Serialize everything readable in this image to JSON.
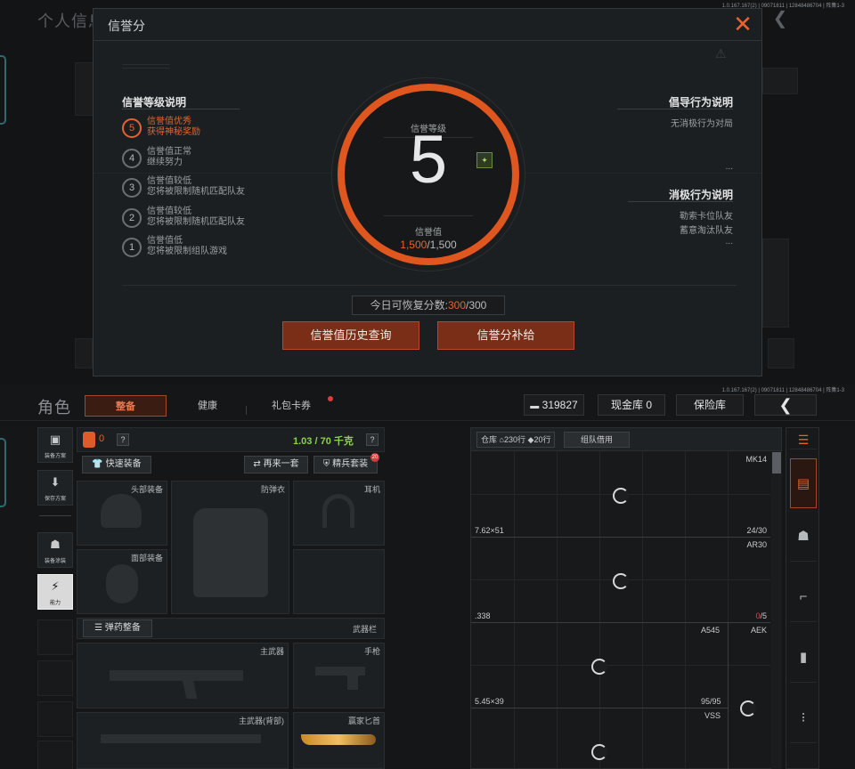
{
  "version_text": "1.0.167.167(2) | 09071811 | 12848486704 | 阵集1-3",
  "background_page": {
    "title": "个人信息"
  },
  "modal": {
    "title": "信誉分",
    "close_icon": "close-icon",
    "levels_heading": "信誉等级说明",
    "levels": [
      {
        "num": "5",
        "line1": "信誉值优秀",
        "line2": "获得神秘奖励",
        "active": true
      },
      {
        "num": "4",
        "line1": "信誉值正常",
        "line2": "继续努力",
        "active": false
      },
      {
        "num": "3",
        "line1": "信誉值较低",
        "line2": "您将被限制随机匹配队友",
        "active": false
      },
      {
        "num": "2",
        "line1": "信誉值较低",
        "line2": "您将被限制随机匹配队友",
        "active": false
      },
      {
        "num": "1",
        "line1": "信誉值低",
        "line2": "您将被限制组队游戏",
        "active": false
      }
    ],
    "center": {
      "level_label": "信誉等级",
      "level_value": "5",
      "score_label": "信誉值",
      "score_current": "1,500",
      "score_max": "/1,500"
    },
    "guide": {
      "heading": "倡导行为说明",
      "items": [
        "无消极行为对局",
        "..."
      ]
    },
    "negative": {
      "heading": "消极行为说明",
      "items": [
        "勒索卡位队友",
        "蓄意淘汰队友",
        "..."
      ]
    },
    "recover": {
      "prefix": "今日可恢复分数:",
      "current": "300",
      "max": "/300"
    },
    "buttons": {
      "history": "信誉值历史查询",
      "supplement": "信誉分补给"
    }
  },
  "loadout": {
    "title": "角色",
    "tabs": [
      {
        "label": "整备",
        "active": true
      },
      {
        "label": "健康",
        "active": false
      },
      {
        "label": "礼包卡券",
        "active": false
      }
    ],
    "currency": "319827",
    "cash_vault": "现金库 0",
    "safe_box": "保险库",
    "side_buttons": {
      "plan": "装备方案",
      "save_plan": "保存方案",
      "skin": "装备涂装",
      "ability": "能力"
    },
    "stats": {
      "armor_value": "0",
      "weight": "1.03 / 70 千克",
      "help": "?"
    },
    "quick_equip": "快速装备",
    "again": "再来一套",
    "elite": "精兵套装",
    "elite_badge": "20",
    "slots": {
      "head": "头部装备",
      "armor": "防弹衣",
      "earphone": "耳机",
      "face": "面部装备",
      "ammo_btn": "弹药整备",
      "weapon_bar": "武器栏",
      "primary": "主武器",
      "pistol": "手枪",
      "primary_back": "主武器(背部)",
      "knife": "赢家匕首"
    },
    "storage": {
      "warehouse_label": "仓库",
      "rows_count": "230行",
      "ammo_rows": "20行",
      "team_credit": "组队借用",
      "rows": [
        {
          "caliber": "7.62×51",
          "weapon": "MK14",
          "count_cur": "24",
          "count_max": "/30",
          "low": false
        },
        {
          "caliber": ".338",
          "weapon": "AR30",
          "count_cur": "0",
          "count_max": "/5",
          "low": true
        },
        {
          "caliber": "5.45×39",
          "weapon": "A545",
          "weapon2": "AEK",
          "count_cur": "95",
          "count_max": "/95",
          "low": false
        },
        {
          "caliber": "",
          "weapon": "VSS",
          "count_cur": "",
          "count_max": "",
          "low": false
        }
      ]
    }
  }
}
